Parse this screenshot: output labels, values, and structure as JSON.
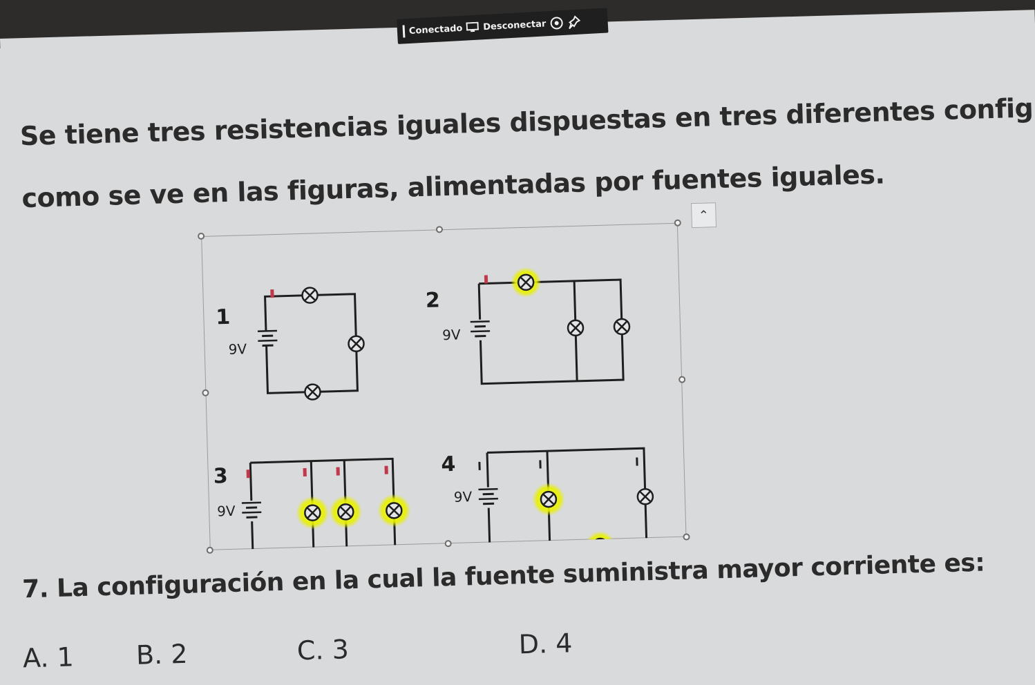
{
  "remote_bar": {
    "connected_label": "Conectado",
    "disconnect_label": "Desconectar",
    "settings_icon": "gear-icon",
    "pin_icon": "pin-icon"
  },
  "slide": {
    "paragraph_line1": "Se tiene tres resistencias iguales dispuestas en tres diferentes configuraciones",
    "paragraph_line2": "como se ve en las figuras, alimentadas por fuentes iguales.",
    "question": "7. La configuración en la cual la fuente suministra mayor corriente es:",
    "options": [
      "A. 1",
      "B. 2",
      "C. 3",
      "D. 4"
    ]
  },
  "figure": {
    "circuits": [
      {
        "number": "1",
        "voltage": "9V"
      },
      {
        "number": "2",
        "voltage": "9V"
      },
      {
        "number": "3",
        "voltage": "9V"
      },
      {
        "number": "4",
        "voltage": "9V"
      }
    ],
    "highlight_color": "#e8f000",
    "wire_color": "#1e1e1e",
    "marker_color": "#c0394b"
  }
}
